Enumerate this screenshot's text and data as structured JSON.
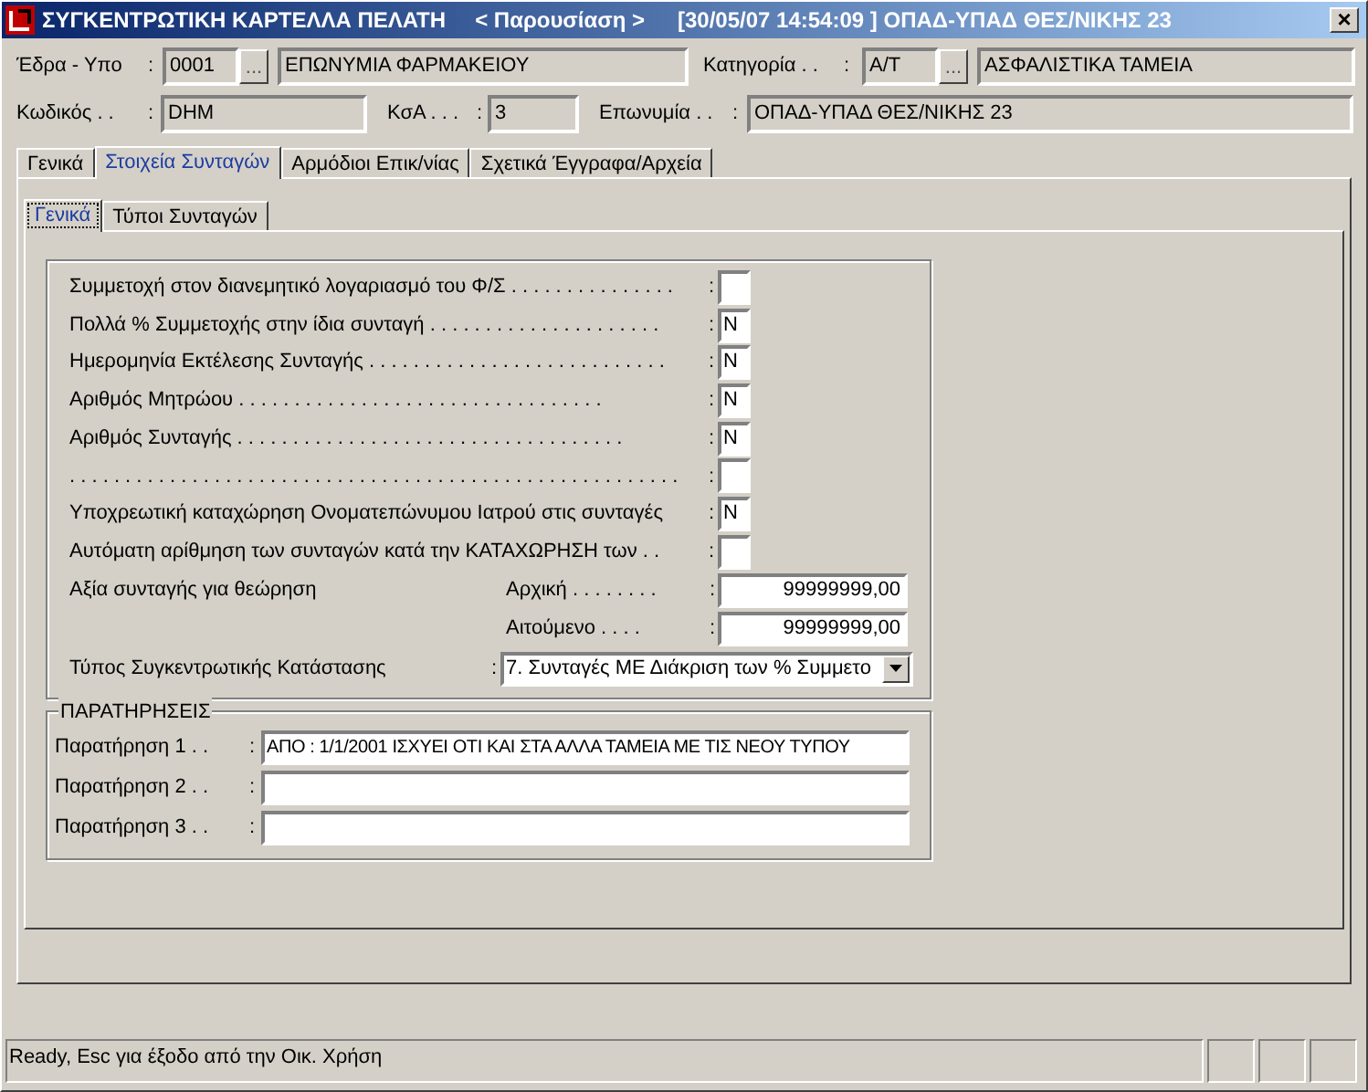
{
  "title_bar": {
    "title": "ΣΥΓΚΕΝΤΡΩΤΙΚΗ ΚΑΡΤΕΛΛΑ ΠΕΛΑΤΗ",
    "mode": "< Παρουσίαση >",
    "info": "[30/05/07 14:54:09 ] ΟΠΑΔ-ΥΠΑΔ ΘΕΣ/ΝΙΚΗΣ 23",
    "close": "×"
  },
  "header": {
    "seat": {
      "label": "Έδρα - Υπο",
      "colon": ":",
      "code": "0001",
      "lookup": "...",
      "name": "ΕΠΩΝΥΜΙΑ ΦΑΡΜΑΚΕΙΟΥ"
    },
    "category": {
      "label": "Κατηγορία . .",
      "colon": ":",
      "code": "Α/Τ",
      "lookup": "...",
      "name": "ΑΣΦΑΛΙΣΤΙΚΑ ΤΑΜΕΙΑ"
    },
    "customer_code": {
      "label": "Κωδικός . .",
      "colon": ":",
      "value": "DHM"
    },
    "ksa": {
      "label": "ΚσΑ . . .",
      "colon": ":",
      "value": "3"
    },
    "company_name": {
      "label": "Επωνυμία . .",
      "colon": ":",
      "value": "ΟΠΑΔ-ΥΠΑΔ ΘΕΣ/ΝΙΚΗΣ 23"
    }
  },
  "tabs": [
    {
      "label": "Γενικά",
      "selected": false
    },
    {
      "label": "Στοιχεία Συνταγών",
      "selected": true
    },
    {
      "label": "Αρμόδιοι Επικ/νίας",
      "selected": false
    },
    {
      "label": "Σχετικά Έγγραφα/Αρχεία",
      "selected": false
    }
  ],
  "subtabs": [
    {
      "label": "Γενικά",
      "selected": true
    },
    {
      "label": "Τύποι Συνταγών",
      "selected": false
    }
  ],
  "settings": [
    {
      "kind": "flag",
      "label": "Συμμετοχή στον διανεμητικό λογαριασμό του Φ/Σ . . . . . . . . . . . . . . .",
      "colon": ":"
    },
    {
      "kind": "flag",
      "label": "Πολλά % Συμμετοχής στην ίδια συνταγή . . . . . . . . . . . . . . . . . . . . .",
      "colon": ":",
      "value": "N"
    },
    {
      "kind": "flag",
      "label": "Ημερομηνία Εκτέλεσης Συνταγής . . . . . . . . . . . . . . . . . . . . . . . . . . .",
      "colon": ":",
      "value": "N"
    },
    {
      "kind": "flag",
      "label": "Αριθμός Μητρώου . . . . . . . . . . . . . . . . . . . . . . . . . . . . . . . . .",
      "colon": ":",
      "value": "N"
    },
    {
      "kind": "flag",
      "label": "Αριθμός Συνταγής . . . . . . . . . . . . . . . . . . . . . . . . . . . . . . . . . . .",
      "colon": ":",
      "value": "N"
    },
    {
      "kind": "flag",
      "label": ". . . . . . . . . . . . . . . . . . . . . . . . . . . . . . . . . . . . . . . . . . . . . . . . . . . . . . .",
      "colon": ":"
    },
    {
      "kind": "flag",
      "label": "Υποχρεωτική καταχώρηση Ονοματεπώνυμου Ιατρού στις συνταγές",
      "colon": ":",
      "value": "N"
    },
    {
      "kind": "flag",
      "label": "Αυτόματη αρίθμηση των συνταγών κατά την ΚΑΤΑΧΩΡΗΣΗ των . .",
      "colon": ":"
    },
    {
      "kind": "amount",
      "label": "Αξία συνταγής για θεώρηση",
      "sublabel": "Αρχική . . . . . . . .",
      "colon": ":",
      "value": "99999999,00"
    },
    {
      "kind": "amount",
      "sublabel": "Αιτούμενο . . . .",
      "colon": ":",
      "value": "99999999,00"
    },
    {
      "kind": "select",
      "label": "Τύπος Συγκεντρωτικής Κατάστασης",
      "colon": ":",
      "value": "7. Συνταγές ΜΕ Διάκριση των % Συμμετο"
    }
  ],
  "remarks": {
    "title": "ΠΑΡΑΤΗΡΗΣΕΙΣ",
    "items": [
      {
        "label": "Παρατήρηση 1 . .",
        "colon": ":",
        "value": "ΑΠΟ : 1/1/2001 ΙΣΧΥΕΙ ΟΤΙ ΚΑΙ ΣΤΑ ΑΛΛΑ ΤΑΜΕΙΑ ΜΕ ΤΙΣ ΝΕΟΥ ΤΥΠΟΥ"
      },
      {
        "label": "Παρατήρηση 2 . .",
        "colon": ":"
      },
      {
        "label": "Παρατήρηση 3 . .",
        "colon": ":"
      }
    ]
  },
  "status_bar": {
    "text": "Ready, Esc για έξοδο από την Οικ. Χρήση"
  }
}
